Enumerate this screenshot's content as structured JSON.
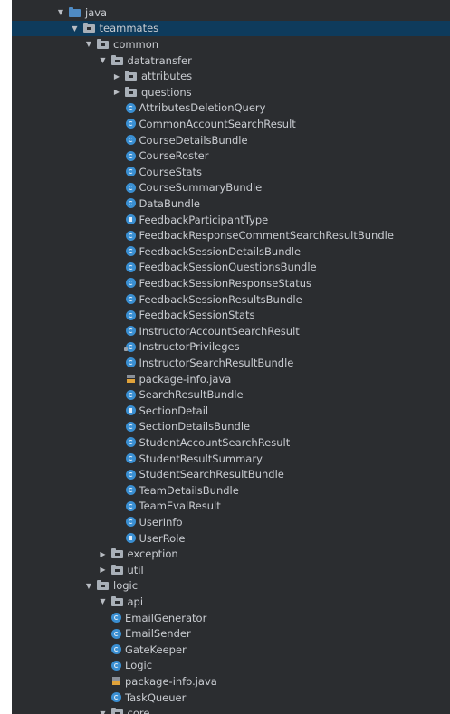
{
  "tree": {
    "nodes": [
      {
        "label": "java",
        "kind": "source-folder",
        "depth": 0,
        "expanded": true
      },
      {
        "label": "teammates",
        "kind": "package",
        "depth": 1,
        "expanded": true,
        "selected": true
      },
      {
        "label": "common",
        "kind": "package",
        "depth": 2,
        "expanded": true
      },
      {
        "label": "datatransfer",
        "kind": "package",
        "depth": 3,
        "expanded": true
      },
      {
        "label": "attributes",
        "kind": "package",
        "depth": 4,
        "expanded": false
      },
      {
        "label": "questions",
        "kind": "package",
        "depth": 4,
        "expanded": false
      },
      {
        "label": "AttributesDeletionQuery",
        "kind": "class",
        "depth": 5
      },
      {
        "label": "CommonAccountSearchResult",
        "kind": "class",
        "depth": 5
      },
      {
        "label": "CourseDetailsBundle",
        "kind": "class",
        "depth": 5
      },
      {
        "label": "CourseRoster",
        "kind": "class",
        "depth": 5
      },
      {
        "label": "CourseStats",
        "kind": "class",
        "depth": 5
      },
      {
        "label": "CourseSummaryBundle",
        "kind": "class",
        "depth": 5
      },
      {
        "label": "DataBundle",
        "kind": "class",
        "depth": 5
      },
      {
        "label": "FeedbackParticipantType",
        "kind": "enum",
        "depth": 5
      },
      {
        "label": "FeedbackResponseCommentSearchResultBundle",
        "kind": "class",
        "depth": 5
      },
      {
        "label": "FeedbackSessionDetailsBundle",
        "kind": "class",
        "depth": 5
      },
      {
        "label": "FeedbackSessionQuestionsBundle",
        "kind": "class",
        "depth": 5
      },
      {
        "label": "FeedbackSessionResponseStatus",
        "kind": "class",
        "depth": 5
      },
      {
        "label": "FeedbackSessionResultsBundle",
        "kind": "class",
        "depth": 5
      },
      {
        "label": "FeedbackSessionStats",
        "kind": "class",
        "depth": 5
      },
      {
        "label": "InstructorAccountSearchResult",
        "kind": "class",
        "depth": 5
      },
      {
        "label": "InstructorPrivileges",
        "kind": "class-locked",
        "depth": 5
      },
      {
        "label": "InstructorSearchResultBundle",
        "kind": "class",
        "depth": 5
      },
      {
        "label": "package-info.java",
        "kind": "java-file",
        "depth": 5
      },
      {
        "label": "SearchResultBundle",
        "kind": "class",
        "depth": 5
      },
      {
        "label": "SectionDetail",
        "kind": "enum",
        "depth": 5
      },
      {
        "label": "SectionDetailsBundle",
        "kind": "class",
        "depth": 5
      },
      {
        "label": "StudentAccountSearchResult",
        "kind": "class",
        "depth": 5
      },
      {
        "label": "StudentResultSummary",
        "kind": "class",
        "depth": 5
      },
      {
        "label": "StudentSearchResultBundle",
        "kind": "class",
        "depth": 5
      },
      {
        "label": "TeamDetailsBundle",
        "kind": "class",
        "depth": 5
      },
      {
        "label": "TeamEvalResult",
        "kind": "class",
        "depth": 5
      },
      {
        "label": "UserInfo",
        "kind": "class",
        "depth": 5
      },
      {
        "label": "UserRole",
        "kind": "enum",
        "depth": 5
      },
      {
        "label": "exception",
        "kind": "package",
        "depth": 3,
        "expanded": false
      },
      {
        "label": "util",
        "kind": "package",
        "depth": 3,
        "expanded": false
      },
      {
        "label": "logic",
        "kind": "package",
        "depth": 2,
        "expanded": true
      },
      {
        "label": "api",
        "kind": "package",
        "depth": 3,
        "expanded": true
      },
      {
        "label": "EmailGenerator",
        "kind": "class",
        "depth": 4
      },
      {
        "label": "EmailSender",
        "kind": "class",
        "depth": 4
      },
      {
        "label": "GateKeeper",
        "kind": "class",
        "depth": 4
      },
      {
        "label": "Logic",
        "kind": "class",
        "depth": 4
      },
      {
        "label": "package-info.java",
        "kind": "java-file",
        "depth": 4
      },
      {
        "label": "TaskQueuer",
        "kind": "class",
        "depth": 4
      },
      {
        "label": "core",
        "kind": "package",
        "depth": 3,
        "expanded": true
      }
    ]
  },
  "colors": {
    "panel_background": "#2b2d30",
    "selection": "#0e3b5c",
    "text": "#c9ccd1",
    "class_icon": "#3a8fd2",
    "source_folder_icon": "#4f8bc4",
    "package_icon": "#a9b0b8"
  }
}
